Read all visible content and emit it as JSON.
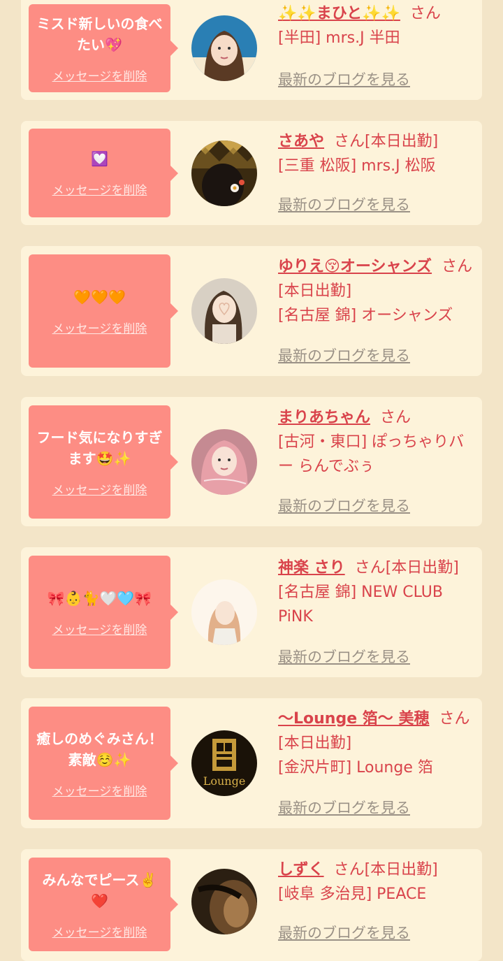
{
  "delete_label": "メッセージを削除",
  "blog_label": "最新のブログを見る",
  "colors": {
    "bubble": "#fd8d84",
    "card": "#fdf3da",
    "page_bg": "#f3e5c8",
    "name": "#d9434b",
    "link_gray": "#9a9186"
  },
  "cards": [
    {
      "message": "ミスド新しいの食べたい💖",
      "name": "✨✨まひと✨✨",
      "san": "さん",
      "status": "",
      "shop": "[半田] mrs.J 半田",
      "avatar": "avatar-photo-woman"
    },
    {
      "message": "💟",
      "name": "さあや",
      "san": "さん",
      "status": "[本日出勤]",
      "shop": "[三重 松阪] mrs.J 松阪",
      "avatar": "avatar-photo-hair-ornament"
    },
    {
      "message": "🧡🧡🧡",
      "name": "ゆりえ😚オーシャンズ",
      "san": "さん",
      "status": "[本日出勤]",
      "shop": "[名古屋 錦] オーシャンズ",
      "avatar": "avatar-photo-heart-face"
    },
    {
      "message": "フード気になりすぎます🤩✨",
      "name": "まりあちゃん",
      "san": "さん",
      "status": "",
      "shop": "[古河・東口] ぽっちゃりバー らんでぶぅ",
      "avatar": "avatar-photo-pink-hair"
    },
    {
      "message": "🎀👶🐈🤍🩵🎀",
      "name": "神楽 さり",
      "san": "さん",
      "status": "[本日出勤]",
      "shop": "[名古屋 錦] NEW CLUB PiNK",
      "avatar": "avatar-photo-profile"
    },
    {
      "message": "癒しのめぐみさん！素敵☺️✨",
      "name": "〜Lounge 箔〜 美穂",
      "san": "さん",
      "status": "[本日出勤]",
      "shop": "[金沢片町] Lounge 箔",
      "avatar": "avatar-logo-lounge",
      "logo_text": "Lounge"
    },
    {
      "message": "みんなでピース✌️❤️",
      "name": "しずく",
      "san": "さん",
      "status": "[本日出勤]",
      "shop": "[岐阜 多治見] PEACE",
      "avatar": "avatar-photo-dark"
    }
  ]
}
